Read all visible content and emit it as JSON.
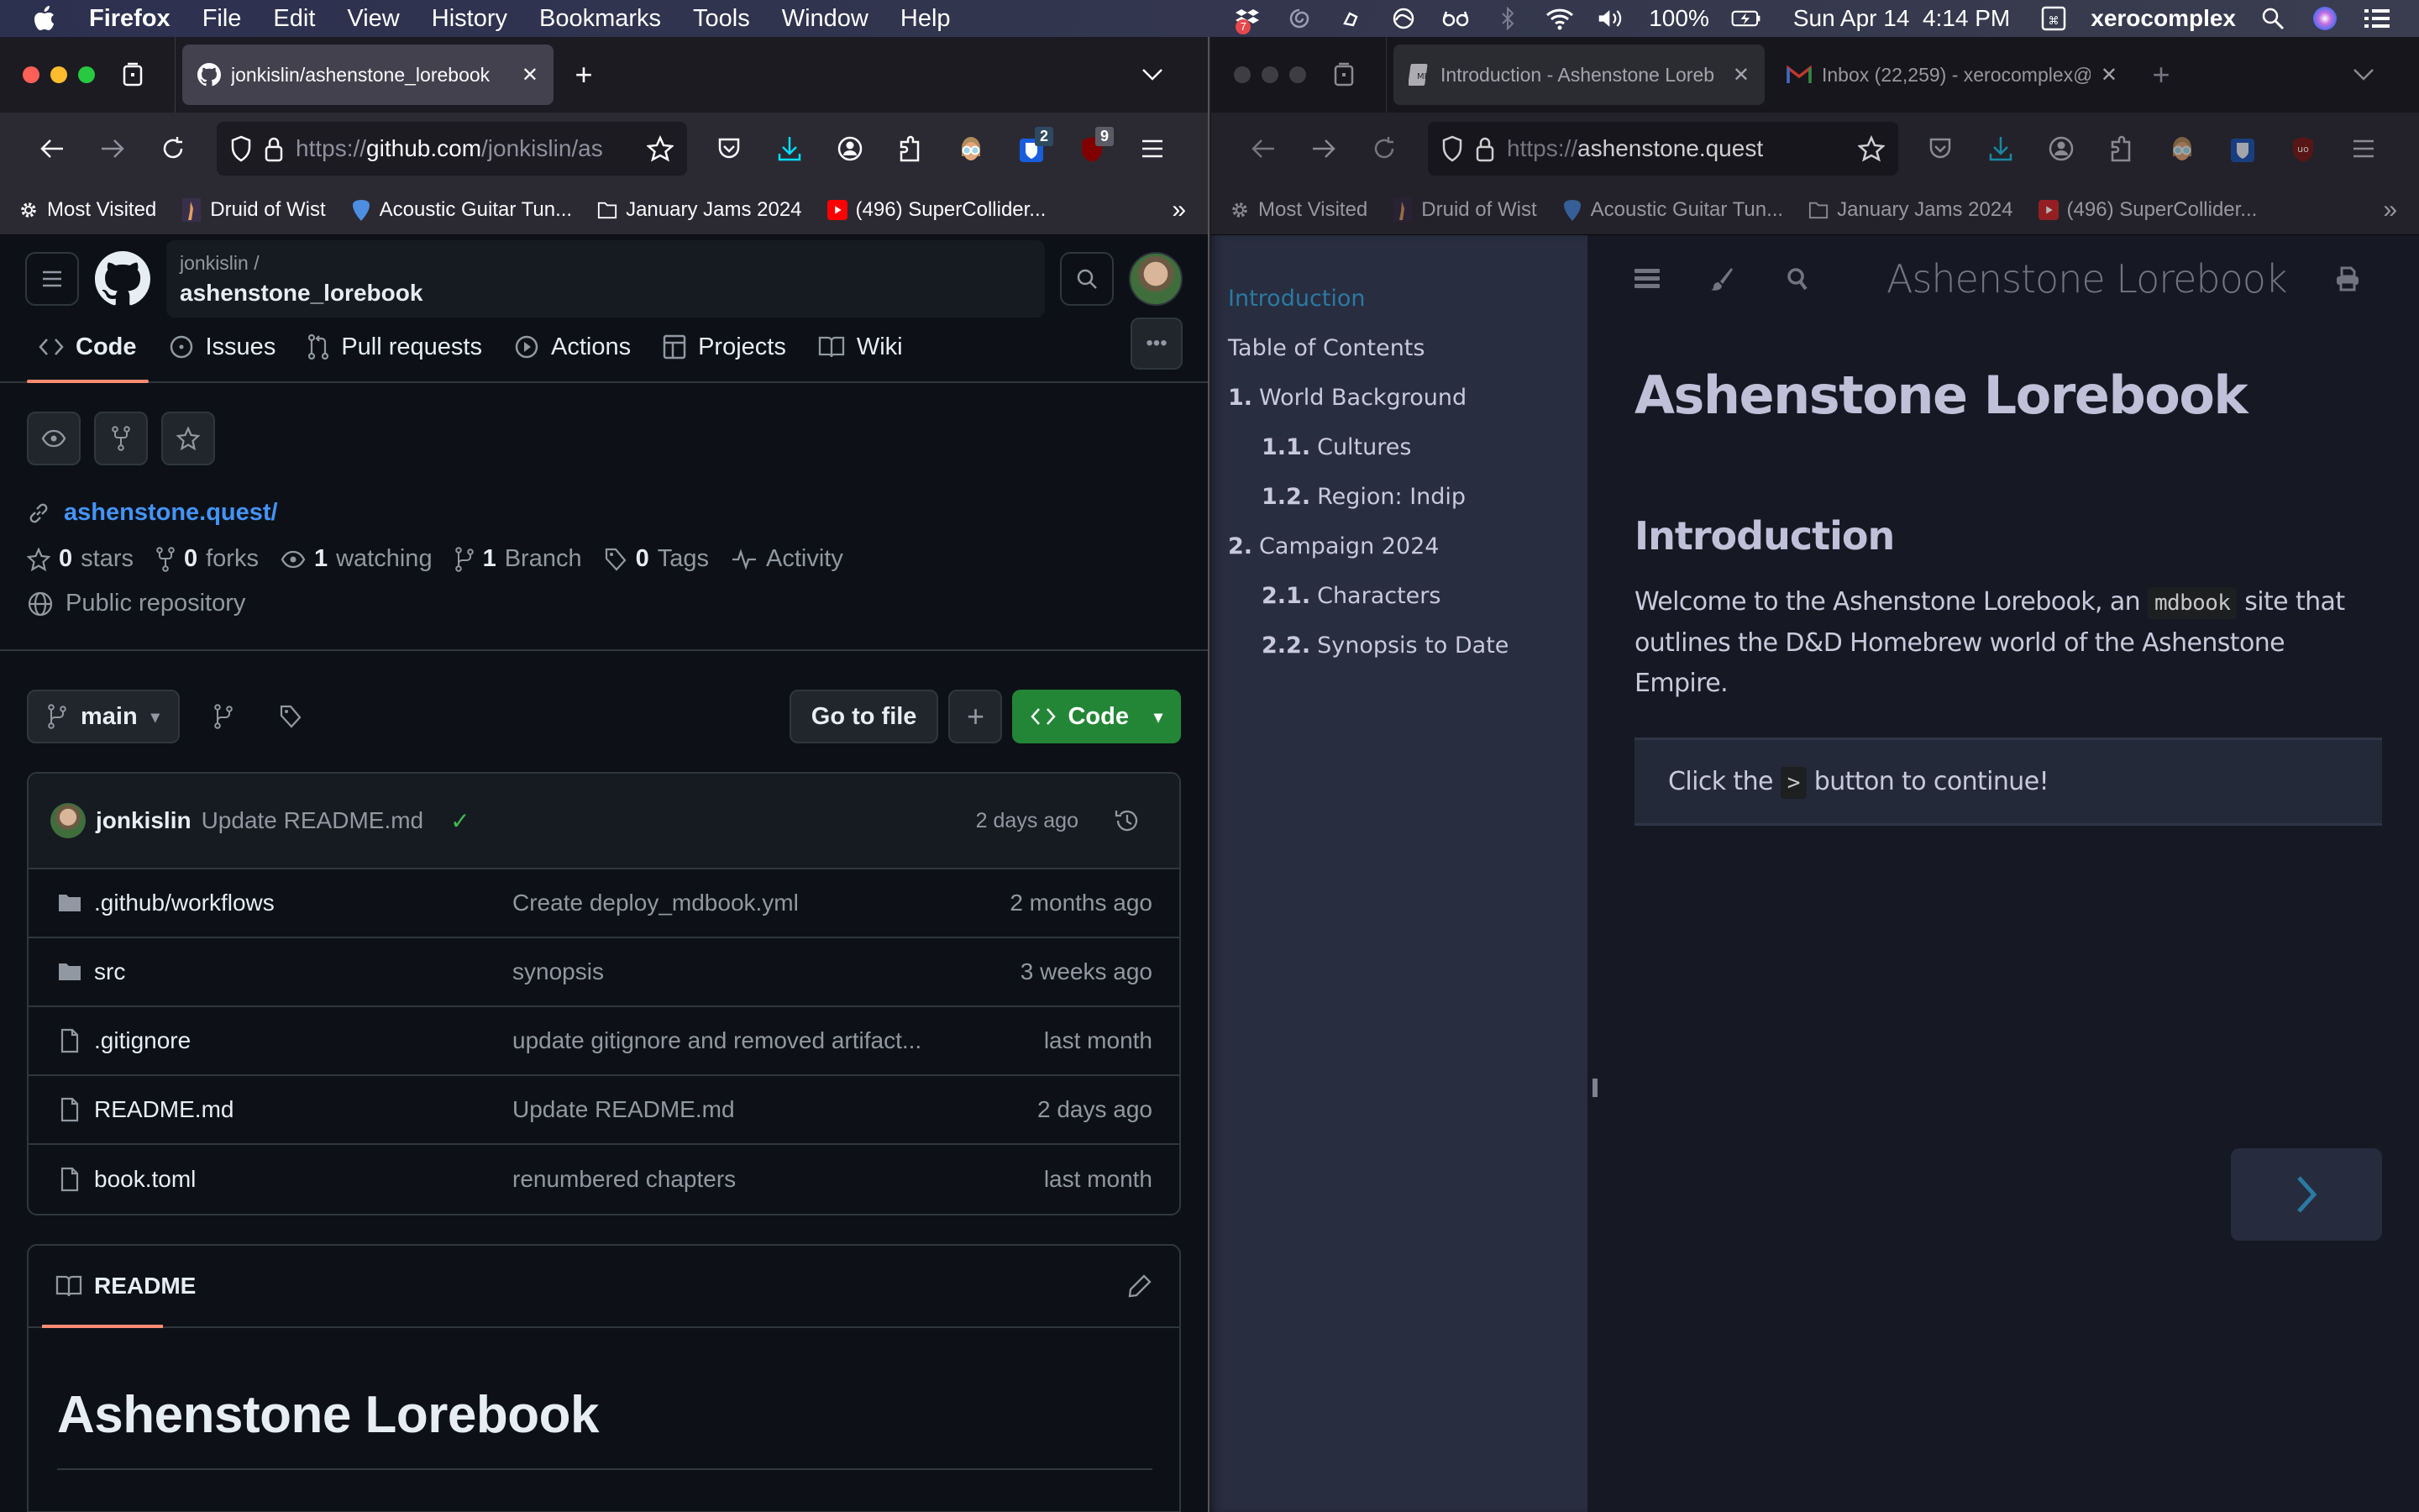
{
  "menubar": {
    "app": "Firefox",
    "items": [
      "File",
      "Edit",
      "View",
      "History",
      "Bookmarks",
      "Tools",
      "Window",
      "Help"
    ],
    "status": {
      "dropbox_badge": "7",
      "battery": "100%",
      "datetime": "Sun Apr 14  4:14 PM",
      "user": "xerocomplex"
    }
  },
  "left_window": {
    "tab": {
      "title": "jonkislin/ashenstone_lorebook",
      "icon": "github-icon"
    },
    "url": {
      "prefix": "https://",
      "host": "github.com",
      "path": "/jonkislin/as"
    },
    "extension_badges": {
      "bitwarden": "2",
      "ublock": "9"
    },
    "bookmarks": [
      {
        "label": "Most Visited",
        "icon": "gear-icon"
      },
      {
        "label": "Druid of Wist",
        "icon": "druid-icon"
      },
      {
        "label": "Acoustic Guitar Tun...",
        "icon": "guitar-pick-icon"
      },
      {
        "label": "January Jams 2024",
        "icon": "folder-icon"
      },
      {
        "label": "(496) SuperCollider...",
        "icon": "youtube-icon"
      }
    ]
  },
  "github": {
    "owner": "jonkislin /",
    "repo": "ashenstone_lorebook",
    "tabs": [
      {
        "label": "Code",
        "icon": "code-icon",
        "active": true
      },
      {
        "label": "Issues",
        "icon": "issue-icon"
      },
      {
        "label": "Pull requests",
        "icon": "pull-request-icon"
      },
      {
        "label": "Actions",
        "icon": "play-icon"
      },
      {
        "label": "Projects",
        "icon": "table-icon"
      },
      {
        "label": "Wiki",
        "icon": "book-icon"
      }
    ],
    "website": "ashenstone.quest/",
    "stats": {
      "stars_count": "0",
      "stars_label": "stars",
      "forks_count": "0",
      "forks_label": "forks",
      "watching_count": "1",
      "watching_label": "watching",
      "branch_count": "1",
      "branch_label": "Branch",
      "tags_count": "0",
      "tags_label": "Tags",
      "activity_label": "Activity"
    },
    "visibility": "Public repository",
    "branch": "main",
    "go_to_file": "Go to file",
    "code_button": "Code",
    "latest_commit": {
      "author": "jonkislin",
      "message": "Update README.md",
      "status": "success",
      "time": "2 days ago"
    },
    "files": [
      {
        "type": "folder",
        "name": ".github/workflows",
        "message": "Create deploy_mdbook.yml",
        "age": "2 months ago"
      },
      {
        "type": "folder",
        "name": "src",
        "message": "synopsis",
        "age": "3 weeks ago"
      },
      {
        "type": "file",
        "name": ".gitignore",
        "message": "update gitignore and removed artifact...",
        "age": "last month"
      },
      {
        "type": "file",
        "name": "README.md",
        "message": "Update README.md",
        "age": "2 days ago"
      },
      {
        "type": "file",
        "name": "book.toml",
        "message": "renumbered chapters",
        "age": "last month"
      }
    ],
    "readme": {
      "label": "README",
      "heading": "Ashenstone Lorebook"
    }
  },
  "right_window": {
    "tabs": [
      {
        "title": "Introduction - Ashenstone Loreb",
        "icon": "mdbook-icon",
        "active": true
      },
      {
        "title": "Inbox (22,259) - xerocomplex@",
        "icon": "gmail-icon"
      }
    ],
    "url": {
      "prefix": "https://",
      "host": "ashenstone.quest"
    },
    "bookmarks": [
      {
        "label": "Most Visited"
      },
      {
        "label": "Druid of Wist"
      },
      {
        "label": "Acoustic Guitar Tun..."
      },
      {
        "label": "January Jams 2024"
      },
      {
        "label": "(496) SuperCollider..."
      }
    ]
  },
  "mdbook": {
    "site_title": "Ashenstone Lorebook",
    "toc": [
      {
        "num": "",
        "label": "Introduction",
        "active": true,
        "level": 0
      },
      {
        "num": "",
        "label": "Table of Contents",
        "level": 0
      },
      {
        "num": "1.",
        "label": "World Background",
        "level": 0
      },
      {
        "num": "1.1.",
        "label": "Cultures",
        "level": 1
      },
      {
        "num": "1.2.",
        "label": "Region: Indip",
        "level": 1
      },
      {
        "num": "2.",
        "label": "Campaign 2024",
        "level": 0
      },
      {
        "num": "2.1.",
        "label": "Characters",
        "level": 1
      },
      {
        "num": "2.2.",
        "label": "Synopsis to Date",
        "level": 1
      }
    ],
    "h1": "Ashenstone Lorebook",
    "h2": "Introduction",
    "para_before_code": "Welcome to the Ashenstone Lorebook, an ",
    "para_code": "mdbook",
    "para_after_code": " site that outlines the D&D Homebrew world of the Ashenstone Empire.",
    "quote_before": "Click the ",
    "quote_code": ">",
    "quote_after": " button to continue!"
  },
  "colors": {
    "gh_accent": "#fd8c73",
    "gh_link": "#4493f8",
    "gh_green": "#238636",
    "md_link": "#2b79a2"
  }
}
